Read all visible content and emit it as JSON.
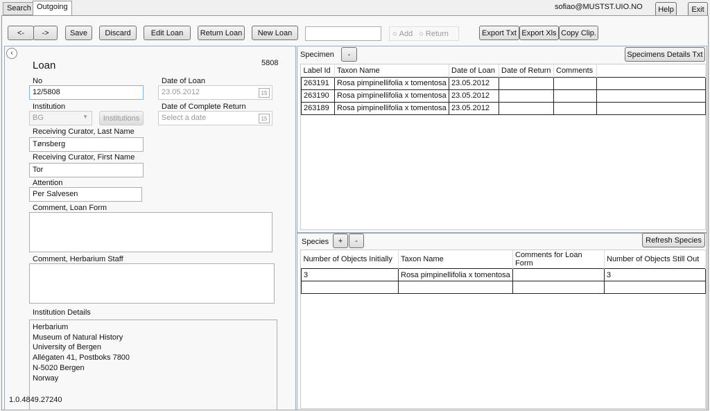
{
  "tabs": [
    {
      "label": "Search"
    },
    {
      "label": "Outgoing"
    }
  ],
  "user": "sofiao@MUSTST.UIO.NO",
  "help": "Help",
  "exit": "Exit",
  "toolbar": {
    "back": "<-",
    "forward": "->",
    "save": "Save",
    "discard": "Discard",
    "edit_loan": "Edit Loan",
    "return_loan": "Return Loan",
    "new_loan": "New Loan",
    "search_value": "",
    "add": "Add",
    "return": "Return",
    "export_txt": "Export Txt",
    "export_xls": "Export Xls",
    "copy_clip": "Copy Clip."
  },
  "loan": {
    "title": "Loan",
    "id": "5808",
    "no_label": "No",
    "no": "12/5808",
    "date_loan_label": "Date of Loan",
    "date_loan": "23.05.2012",
    "date_return_label": "Date of Complete Return",
    "date_return_placeholder": "Select a date",
    "institution_label": "Institution",
    "institution": "BG",
    "institutions_btn": "Institutions",
    "last_name_label": "Receiving Curator, Last Name",
    "last_name": "Tønsberg",
    "first_name_label": "Receiving Curator, First Name",
    "first_name": "Tor",
    "attention_label": "Attention",
    "attention": "Per Salvesen",
    "comment_loan_label": "Comment, Loan Form",
    "comment_staff_label": "Comment, Herbarium Staff",
    "inst_details_label": "Institution Details",
    "inst_details": [
      "Herbarium",
      "Museum of Natural History",
      "University of Bergen",
      "Allégaten 41, Postboks 7800",
      "N-5020 Bergen",
      "Norway"
    ],
    "calendar_day": "15"
  },
  "version": "1.0.4849.27240",
  "specimen": {
    "label": "Specimen",
    "remove": "-",
    "details_btn": "Specimens Details Txt",
    "columns": [
      "Label Id",
      "Taxon Name",
      "Date of Loan",
      "Date of Return",
      "Comments"
    ],
    "rows": [
      [
        "263191",
        "Rosa pimpinellifolia x tomentosa",
        "23.05.2012",
        "",
        ""
      ],
      [
        "263190",
        "Rosa pimpinellifolia x tomentosa",
        "23.05.2012",
        "",
        ""
      ],
      [
        "263189",
        "Rosa pimpinellifolia x tomentosa",
        "23.05.2012",
        "",
        ""
      ]
    ]
  },
  "species": {
    "label": "Species",
    "add": "+",
    "remove": "-",
    "refresh_btn": "Refresh Species",
    "columns": [
      "Number of Objects Initially",
      "Taxon Name",
      "Comments for Loan Form",
      "Number of Objects Still Out"
    ],
    "rows": [
      [
        "3",
        "Rosa pimpinellifolia x tomentosa",
        "",
        "3"
      ],
      [
        "",
        "",
        "",
        ""
      ]
    ]
  }
}
